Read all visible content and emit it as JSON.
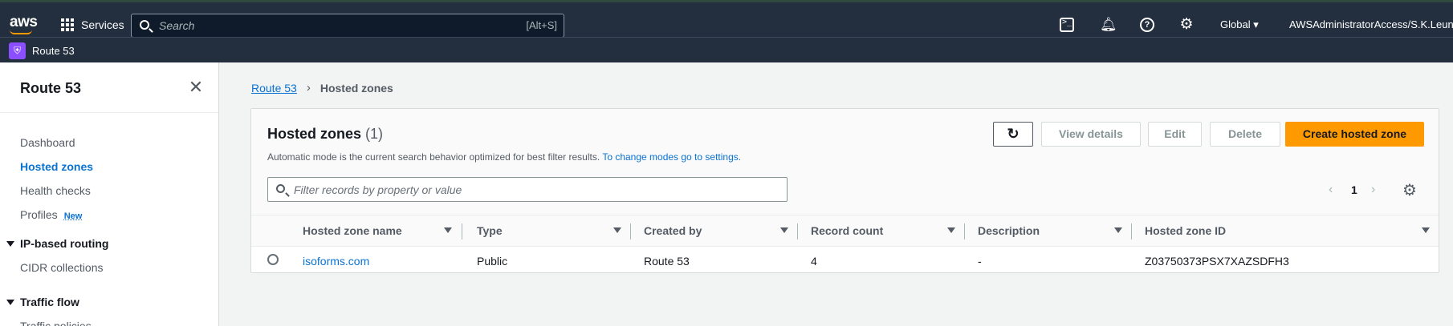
{
  "topnav": {
    "logo": "aws",
    "services_label": "Services",
    "search_placeholder": "Search",
    "search_shortcut": "[Alt+S]",
    "region": "Global ▾",
    "account": "AWSAdministratorAccess/S.K.Leung@"
  },
  "servicebar": {
    "service_name": "Route 53"
  },
  "sidebar": {
    "title": "Route 53",
    "items": [
      {
        "label": "Dashboard"
      },
      {
        "label": "Hosted zones"
      },
      {
        "label": "Health checks"
      },
      {
        "label": "Profiles",
        "badge": "New"
      }
    ],
    "sections": [
      {
        "label": "IP-based routing",
        "items": [
          "CIDR collections"
        ]
      },
      {
        "label": "Traffic flow",
        "items": [
          "Traffic policies"
        ]
      }
    ]
  },
  "breadcrumb": {
    "root": "Route 53",
    "current": "Hosted zones"
  },
  "panel": {
    "title": "Hosted zones",
    "count": "(1)",
    "description": "Automatic mode is the current search behavior optimized for best filter results.",
    "description_link": "To change modes go to settings.",
    "buttons": {
      "refresh": "↻",
      "view_details": "View details",
      "edit": "Edit",
      "delete": "Delete",
      "create": "Create hosted zone"
    },
    "filter_placeholder": "Filter records by property or value",
    "pagination": {
      "prev": "‹",
      "page": "1",
      "next": "›",
      "settings": "⚙"
    }
  },
  "table": {
    "columns": [
      "Hosted zone name",
      "Type",
      "Created by",
      "Record count",
      "Description",
      "Hosted zone ID"
    ],
    "rows": [
      [
        "isoforms.com",
        "Public",
        "Route 53",
        "4",
        "-",
        "Z03750373PSX7XAZSDFH3"
      ]
    ]
  },
  "colors": {
    "primary_button": "#ff9900",
    "link": "#0972d3",
    "header_bg": "#232f3e"
  }
}
